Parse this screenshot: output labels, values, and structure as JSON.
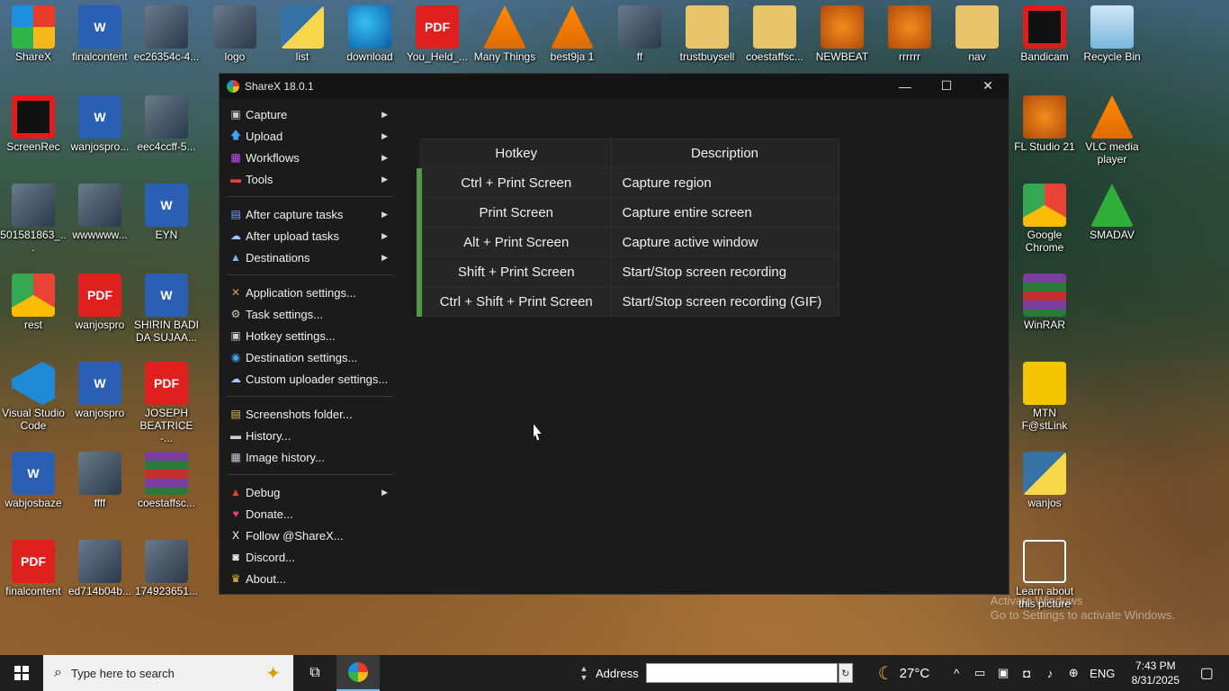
{
  "desktop": {
    "icons": [
      {
        "label": "ShareX",
        "glyph": "",
        "cls": "g-sharex"
      },
      {
        "label": "finalcontent",
        "glyph": "W",
        "cls": "g-word"
      },
      {
        "label": "ec26354c-4...",
        "glyph": "",
        "cls": "g-photo"
      },
      {
        "label": "logo",
        "glyph": "",
        "cls": "g-photo"
      },
      {
        "label": "list",
        "glyph": "",
        "cls": "g-py"
      },
      {
        "label": "download",
        "glyph": "",
        "cls": "g-edge"
      },
      {
        "label": "You_Held_...",
        "glyph": "PDF",
        "cls": "g-pdf"
      },
      {
        "label": "Many Things",
        "glyph": "",
        "cls": "g-vlc"
      },
      {
        "label": "best9ja 1",
        "glyph": "",
        "cls": "g-vlc"
      },
      {
        "label": "ff",
        "glyph": "",
        "cls": "g-photo"
      },
      {
        "label": "trustbuysell",
        "glyph": "",
        "cls": "g-folder"
      },
      {
        "label": "coestaffsc...",
        "glyph": "",
        "cls": "g-folder"
      },
      {
        "label": "NEWBEAT",
        "glyph": "",
        "cls": "g-fl"
      },
      {
        "label": "rrrrrr",
        "glyph": "",
        "cls": "g-fl"
      },
      {
        "label": "nav",
        "glyph": "",
        "cls": "g-folder"
      },
      {
        "label": "Bandicam",
        "glyph": "",
        "cls": "g-rec"
      },
      {
        "label": "Recycle Bin",
        "glyph": "",
        "cls": "g-recycle"
      },
      {
        "label": "ScreenRec",
        "glyph": "",
        "cls": "g-rec"
      },
      {
        "label": "wanjospro...",
        "glyph": "W",
        "cls": "g-word"
      },
      {
        "label": "eec4ccff-5...",
        "glyph": "",
        "cls": "g-photo"
      },
      {
        "label": "FL Studio 21",
        "glyph": "",
        "cls": "g-fl"
      },
      {
        "label": "VLC media player",
        "glyph": "",
        "cls": "g-vlc"
      },
      {
        "label": "501581863_...",
        "glyph": "",
        "cls": "g-photo"
      },
      {
        "label": "wwwwww...",
        "glyph": "",
        "cls": "g-photo"
      },
      {
        "label": "EYN",
        "glyph": "W",
        "cls": "g-word"
      },
      {
        "label": "Google Chrome",
        "glyph": "",
        "cls": "g-chrome"
      },
      {
        "label": "SMADAV",
        "glyph": "",
        "cls": "g-smad"
      },
      {
        "label": "rest",
        "glyph": "",
        "cls": "g-chrome"
      },
      {
        "label": "wanjospro",
        "glyph": "PDF",
        "cls": "g-pdf"
      },
      {
        "label": "SHIRIN BADI DA SUJAA...",
        "glyph": "W",
        "cls": "g-word"
      },
      {
        "label": "WinRAR",
        "glyph": "",
        "cls": "g-rar"
      },
      {
        "label": "Visual Studio Code",
        "glyph": "",
        "cls": "g-vscode"
      },
      {
        "label": "wanjospro",
        "glyph": "W",
        "cls": "g-word"
      },
      {
        "label": "JOSEPH BEATRICE -...",
        "glyph": "PDF",
        "cls": "g-pdf"
      },
      {
        "label": "MTN F@stLink",
        "glyph": "",
        "cls": "g-mtn"
      },
      {
        "label": "wabjosbaze",
        "glyph": "W",
        "cls": "g-word"
      },
      {
        "label": "ffff",
        "glyph": "",
        "cls": "g-photo"
      },
      {
        "label": "coestaffsc...",
        "glyph": "",
        "cls": "g-rar"
      },
      {
        "label": "wanjos",
        "glyph": "",
        "cls": "g-py"
      },
      {
        "label": "finalcontent",
        "glyph": "PDF",
        "cls": "g-pdf"
      },
      {
        "label": "ed714b04b...",
        "glyph": "",
        "cls": "g-photo"
      },
      {
        "label": "174923651...",
        "glyph": "",
        "cls": "g-photo"
      },
      {
        "label": "Learn about this picture",
        "glyph": "",
        "cls": "g-learn"
      }
    ]
  },
  "window": {
    "title": "ShareX 18.0.1",
    "minimize": "—",
    "maximize": "☐",
    "close": "✕"
  },
  "menu": {
    "groups": [
      [
        {
          "label": "Capture",
          "icon": "▣",
          "icon_color": "#c8c8c8",
          "submenu": true
        },
        {
          "label": "Upload",
          "icon": "🡅",
          "icon_color": "#3ea6ff",
          "submenu": true
        },
        {
          "label": "Workflows",
          "icon": "▦",
          "icon_color": "#d04aff",
          "submenu": true
        },
        {
          "label": "Tools",
          "icon": "▬",
          "icon_color": "#e04040",
          "submenu": true
        }
      ],
      [
        {
          "label": "After capture tasks",
          "icon": "▤",
          "icon_color": "#7aa7ff",
          "submenu": true
        },
        {
          "label": "After upload tasks",
          "icon": "☁",
          "icon_color": "#9ec9ff",
          "submenu": true
        },
        {
          "label": "Destinations",
          "icon": "▲",
          "icon_color": "#7fb3ff",
          "submenu": true
        }
      ],
      [
        {
          "label": "Application settings...",
          "icon": "✕",
          "icon_color": "#d0a060",
          "submenu": false
        },
        {
          "label": "Task settings...",
          "icon": "⚙",
          "icon_color": "#cfcfcf",
          "submenu": false
        },
        {
          "label": "Hotkey settings...",
          "icon": "▣",
          "icon_color": "#cfcfcf",
          "submenu": false
        },
        {
          "label": "Destination settings...",
          "icon": "◉",
          "icon_color": "#3ea6ff",
          "submenu": false
        },
        {
          "label": "Custom uploader settings...",
          "icon": "☁",
          "icon_color": "#9ec9ff",
          "submenu": false
        }
      ],
      [
        {
          "label": "Screenshots folder...",
          "icon": "▤",
          "icon_color": "#e6c35a",
          "submenu": false
        },
        {
          "label": "History...",
          "icon": "▬",
          "icon_color": "#cfcfcf",
          "submenu": false
        },
        {
          "label": "Image history...",
          "icon": "▦",
          "icon_color": "#cfcfcf",
          "submenu": false
        }
      ],
      [
        {
          "label": "Debug",
          "icon": "▲",
          "icon_color": "#e24a2a",
          "submenu": true
        },
        {
          "label": "Donate...",
          "icon": "♥",
          "icon_color": "#ff3b6b",
          "submenu": false
        },
        {
          "label": "Follow @ShareX...",
          "icon": "X",
          "icon_color": "#ffffff",
          "submenu": false
        },
        {
          "label": "Discord...",
          "icon": "◙",
          "icon_color": "#ffffff",
          "submenu": false
        },
        {
          "label": "About...",
          "icon": "♛",
          "icon_color": "#f2c230",
          "submenu": false
        }
      ]
    ]
  },
  "hotkeys": {
    "headers": {
      "hotkey": "Hotkey",
      "description": "Description"
    },
    "rows": [
      {
        "key": "Ctrl + Print Screen",
        "desc": "Capture region"
      },
      {
        "key": "Print Screen",
        "desc": "Capture entire screen"
      },
      {
        "key": "Alt + Print Screen",
        "desc": "Capture active window"
      },
      {
        "key": "Shift + Print Screen",
        "desc": "Start/Stop screen recording"
      },
      {
        "key": "Ctrl + Shift + Print Screen",
        "desc": "Start/Stop screen recording (GIF)"
      }
    ],
    "status_color": "#4d9a3f"
  },
  "watermark": {
    "line1": "Activate Windows",
    "line2": "Go to Settings to activate Windows."
  },
  "taskbar": {
    "search_placeholder": "Type here to search",
    "address_label": "Address",
    "address_value": "",
    "weather_temp": "27°C",
    "language": "ENG",
    "time": "7:43 PM",
    "date": "8/31/2025"
  }
}
